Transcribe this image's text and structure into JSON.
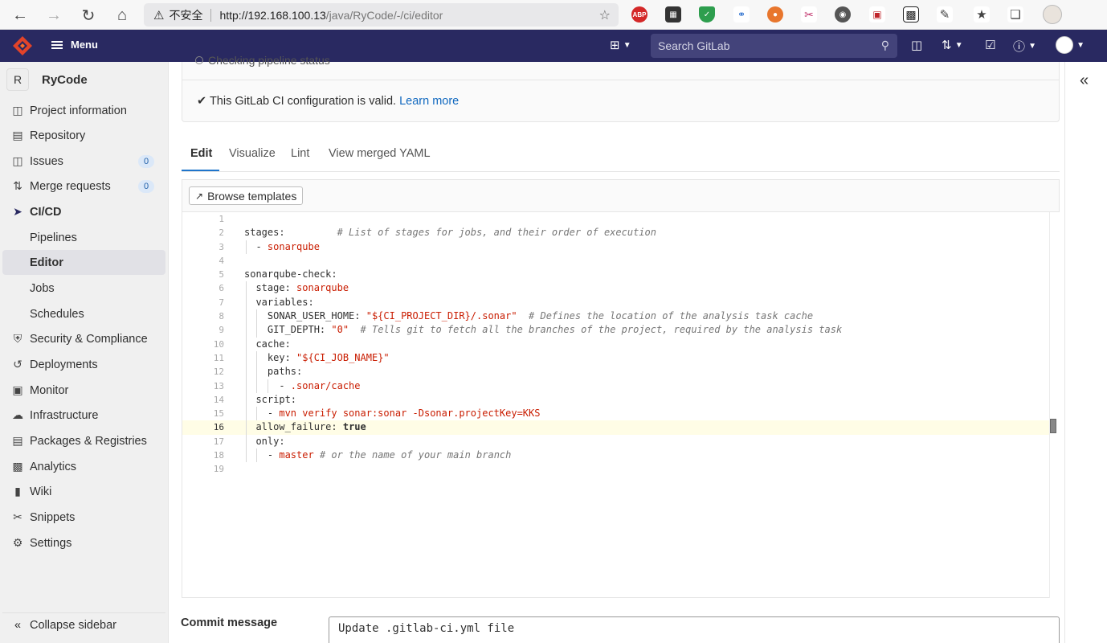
{
  "browser": {
    "insecure_label": "不安全",
    "url_host": "http://192.168.100.13",
    "url_path": "/java/RyCode/-/ci/editor",
    "extensions": [
      "abp-icon",
      "qr-icon",
      "shield-icon",
      "translate-icon",
      "fox-icon",
      "scissors-icon",
      "owl-icon",
      "screen-icon",
      "qr-scan-icon",
      "puzzle-icon",
      "favorites-icon",
      "collections-icon",
      "profile-avatar"
    ],
    "ext_abp_label": "ABP"
  },
  "header": {
    "menu_label": "Menu",
    "search_placeholder": "Search GitLab"
  },
  "sidebar": {
    "project_initial": "R",
    "project_name": "RyCode",
    "items": [
      {
        "label": "Project information",
        "icon": "info-doc-icon"
      },
      {
        "label": "Repository",
        "icon": "doc-icon"
      },
      {
        "label": "Issues",
        "icon": "issues-icon",
        "badge": "0"
      },
      {
        "label": "Merge requests",
        "icon": "merge-request-icon",
        "badge": "0"
      },
      {
        "label": "CI/CD",
        "icon": "rocket-icon"
      },
      {
        "label": "Pipelines"
      },
      {
        "label": "Editor"
      },
      {
        "label": "Jobs"
      },
      {
        "label": "Schedules"
      },
      {
        "label": "Security & Compliance",
        "icon": "shield-icon"
      },
      {
        "label": "Deployments",
        "icon": "deploy-icon"
      },
      {
        "label": "Monitor",
        "icon": "monitor-icon"
      },
      {
        "label": "Infrastructure",
        "icon": "cloud-icon"
      },
      {
        "label": "Packages & Registries",
        "icon": "package-icon"
      },
      {
        "label": "Analytics",
        "icon": "chart-icon"
      },
      {
        "label": "Wiki",
        "icon": "book-icon"
      },
      {
        "label": "Snippets",
        "icon": "snippet-icon"
      },
      {
        "label": "Settings",
        "icon": "gear-icon"
      }
    ],
    "collapse_label": "Collapse sidebar"
  },
  "status": {
    "cut_text": "Checking pipeline status",
    "valid_text": "This GitLab CI configuration is valid.",
    "learn_more": "Learn more"
  },
  "tabs": [
    "Edit",
    "Visualize",
    "Lint",
    "View merged YAML"
  ],
  "editor": {
    "browse_label": "Browse templates",
    "current_line": 16,
    "lines": [
      {
        "n": "1"
      },
      {
        "n": "2"
      },
      {
        "n": "3"
      },
      {
        "n": "4"
      },
      {
        "n": "5"
      },
      {
        "n": "6"
      },
      {
        "n": "7"
      },
      {
        "n": "8"
      },
      {
        "n": "9"
      },
      {
        "n": "10"
      },
      {
        "n": "11"
      },
      {
        "n": "12"
      },
      {
        "n": "13"
      },
      {
        "n": "14"
      },
      {
        "n": "15"
      },
      {
        "n": "16"
      },
      {
        "n": "17"
      },
      {
        "n": "18"
      },
      {
        "n": "19"
      }
    ],
    "code": {
      "l2_key": "stages:",
      "l2_comment": "# List of stages for jobs, and their order of execution",
      "l3_item": "sonarqube",
      "l5_key": "sonarqube-check:",
      "l6_key": "stage:",
      "l6_val": "sonarqube",
      "l7_key": "variables:",
      "l8_key": "SONAR_USER_HOME:",
      "l8_val": "\"${CI_PROJECT_DIR}/.sonar\"",
      "l8_comment": "# Defines the location of the analysis task cache",
      "l9_key": "GIT_DEPTH:",
      "l9_val": "\"0\"",
      "l9_comment": "# Tells git to fetch all the branches of the project, required by the analysis task",
      "l10_key": "cache:",
      "l11_key": "key:",
      "l11_val": "\"${CI_JOB_NAME}\"",
      "l12_key": "paths:",
      "l13_val": ".sonar/cache",
      "l14_key": "script:",
      "l15_val": "mvn verify sonar:sonar -Dsonar.projectKey=KKS",
      "l16_key": "allow_failure:",
      "l16_val": "true",
      "l17_key": "only:",
      "l18_val": "master",
      "l18_comment": "# or the name of your main branch"
    }
  },
  "commit": {
    "label": "Commit message",
    "value": "Update .gitlab-ci.yml file"
  }
}
